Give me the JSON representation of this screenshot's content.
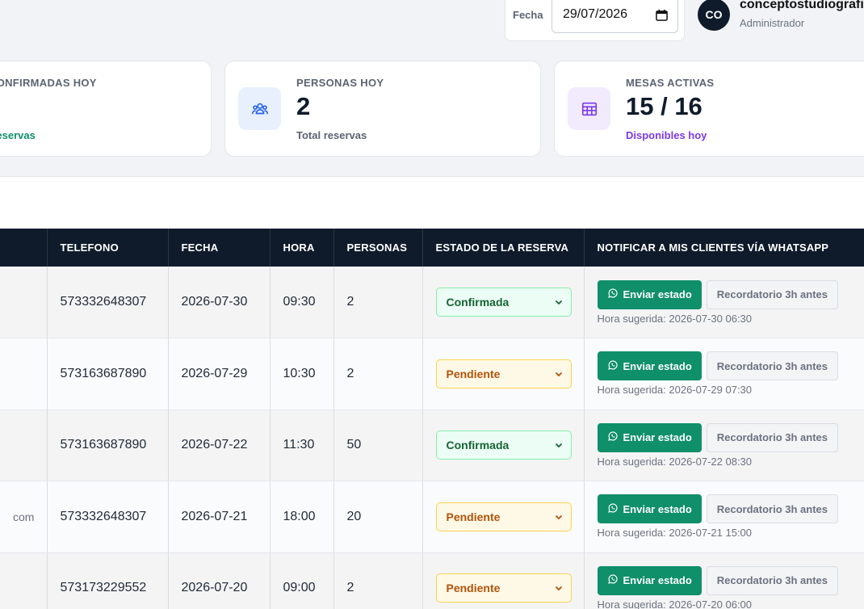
{
  "header": {
    "date_label": "Fecha",
    "date_value": "29/07/2026",
    "avatar_initials": "CO",
    "user_name": "conceptostudiografico",
    "user_role": "Administrador"
  },
  "cards": [
    {
      "label": "CONFIRMADAS HOY",
      "value": "",
      "sub": "Reservas",
      "sub_color": "#0f8f6a"
    },
    {
      "label": "PERSONAS HOY",
      "value": "2",
      "sub": "Total reservas",
      "sub_color": "#5b6472",
      "icon": "people-icon",
      "icon_color": "#2563eb",
      "icon_bg": "#e8f0fe"
    },
    {
      "label": "MESAS ACTIVAS",
      "value": "15 / 16",
      "sub": "Disponibles hoy",
      "sub_color": "#7c3aed",
      "icon": "table-grid-icon",
      "icon_color": "#7c3aed",
      "icon_bg": "#f1ebfd"
    }
  ],
  "table": {
    "headers": [
      "",
      "TELEFONO",
      "FECHA",
      "HORA",
      "PERSONAS",
      "ESTADO DE LA RESERVA",
      "NOTIFICAR A MIS CLIENTES VÍA WHATSAPP"
    ],
    "send_label": "Enviar estado",
    "remind_label": "Recordatorio 3h antes",
    "rows": [
      {
        "first": "",
        "phone": "573332648307",
        "date": "2026-07-30",
        "time": "09:30",
        "people": "2",
        "status": "Confirmada",
        "hint": "Hora sugerida: 2026-07-30 06:30"
      },
      {
        "first": "",
        "phone": "573163687890",
        "date": "2026-07-29",
        "time": "10:30",
        "people": "2",
        "status": "Pendiente",
        "hint": "Hora sugerida: 2026-07-29 07:30"
      },
      {
        "first": "",
        "phone": "573163687890",
        "date": "2026-07-22",
        "time": "11:30",
        "people": "50",
        "status": "Confirmada",
        "hint": "Hora sugerida: 2026-07-22 08:30"
      },
      {
        "first": "com",
        "phone": "573332648307",
        "date": "2026-07-21",
        "time": "18:00",
        "people": "20",
        "status": "Pendiente",
        "hint": "Hora sugerida: 2026-07-21 15:00"
      },
      {
        "first": "",
        "phone": "573173229552",
        "date": "2026-07-20",
        "time": "09:00",
        "people": "2",
        "status": "Pendiente",
        "hint": "Hora sugerida: 2026-07-20 06:00"
      }
    ]
  }
}
